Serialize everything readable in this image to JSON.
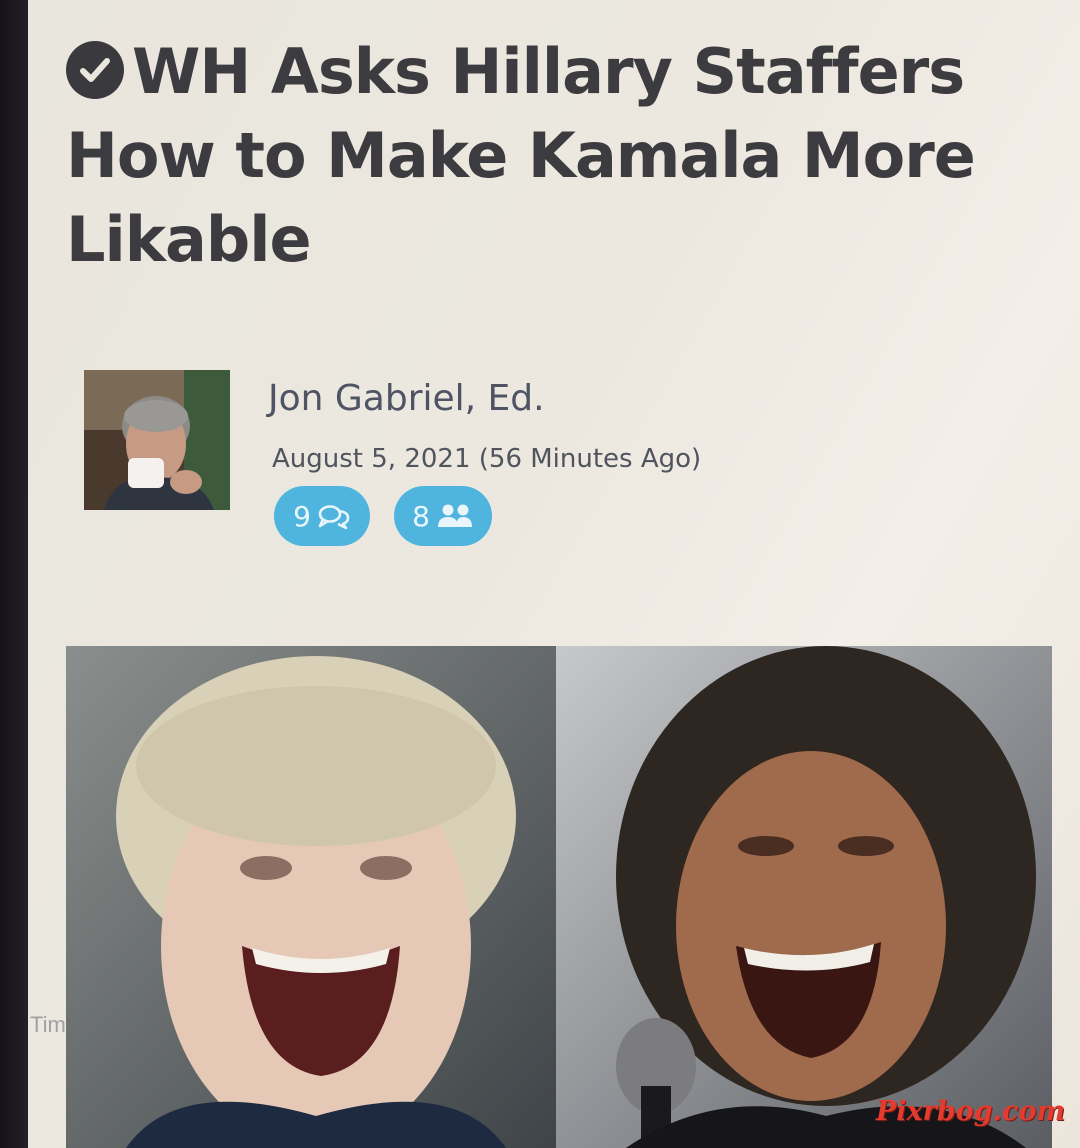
{
  "article": {
    "title": "WH Asks Hillary Staffers How to Make Kamala More Likable",
    "verified_icon": "check-circle-icon"
  },
  "author": {
    "name": "Jon Gabriel, Ed.",
    "avatar_icon": "author-avatar-photo"
  },
  "meta": {
    "date": "August 5, 2021 (56 Minutes Ago)",
    "comments_count": "9",
    "comments_icon": "comments-icon",
    "followers_count": "8",
    "followers_icon": "users-icon"
  },
  "image": {
    "subject": "hero-photo-two-laughing-women"
  },
  "watermark": "Pixrbog.com",
  "colors": {
    "headline": "#3c3b3f",
    "author": "#4e5463",
    "pill": "#4fb4de",
    "watermark": "#e53a2e"
  }
}
